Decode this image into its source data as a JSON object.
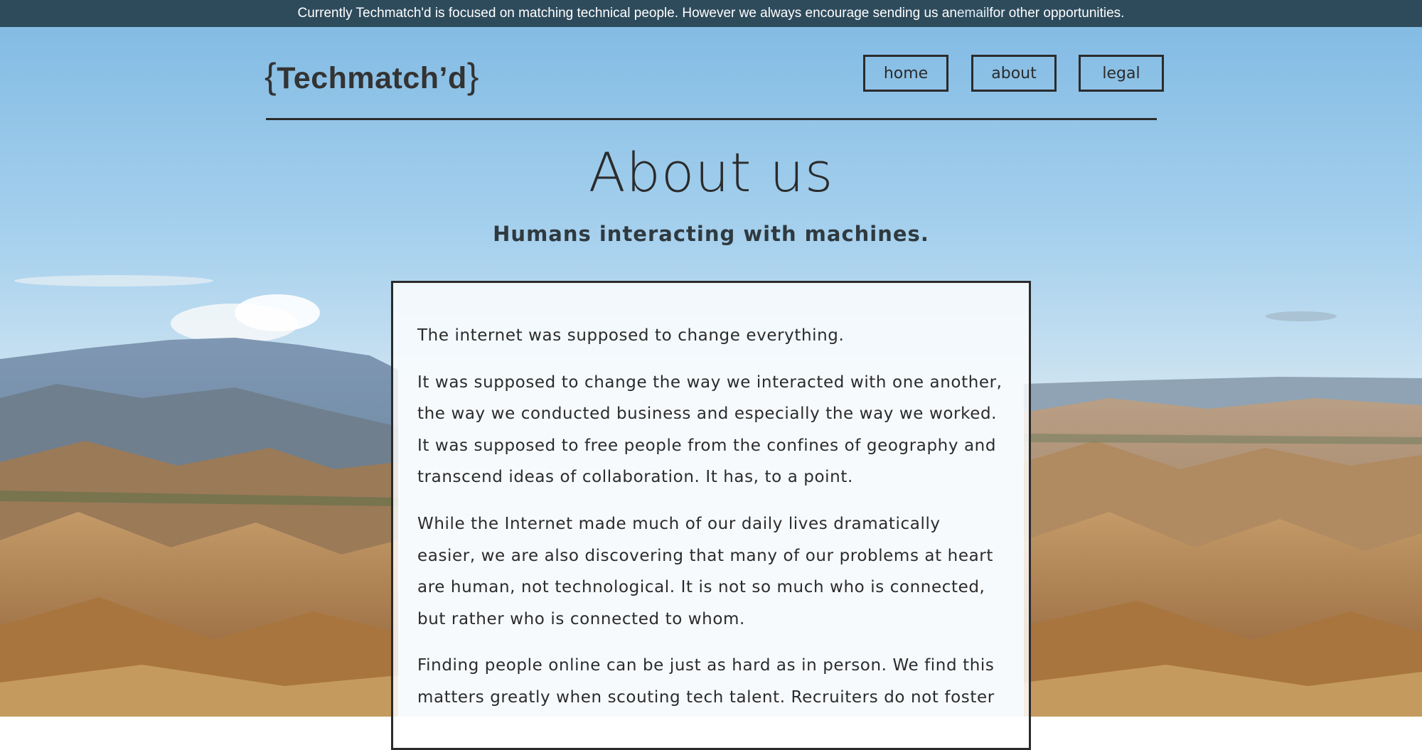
{
  "banner": {
    "text_before": "Currently Techmatch'd is focused on matching technical people. However we always encourage sending us an ",
    "email_link": "email",
    "text_after": " for other opportunities."
  },
  "header": {
    "logo_brace_open": "{",
    "logo_text": "Techmatch’d",
    "logo_brace_close": "}"
  },
  "nav": {
    "items": [
      {
        "label": "home"
      },
      {
        "label": "about"
      },
      {
        "label": "legal"
      }
    ]
  },
  "main": {
    "title": "About us",
    "subtitle": "Humans interacting with machines.",
    "paragraphs": [
      "The internet was supposed to change everything.",
      "It was supposed to change the way we interacted with one another, the way we conducted business and especially the way we worked. It was supposed to free people from the confines of geography and transcend ideas of collaboration. It has, to a point.",
      "While the Internet made much of our daily lives dramatically easier, we are also discovering that many of our problems at heart are human, not technological. It is not so much who is connected, but rather who is connected to whom.",
      "Finding people online can be just as hard as in person. We find this matters greatly when scouting tech talent. Recruiters do not foster"
    ]
  },
  "colors": {
    "banner_bg": "#2e4b5c",
    "text_dark": "#2b2b2b",
    "sky_top": "#8cc3e6",
    "sky_bottom": "#d7e8f0",
    "hills": "#b48a5c"
  }
}
